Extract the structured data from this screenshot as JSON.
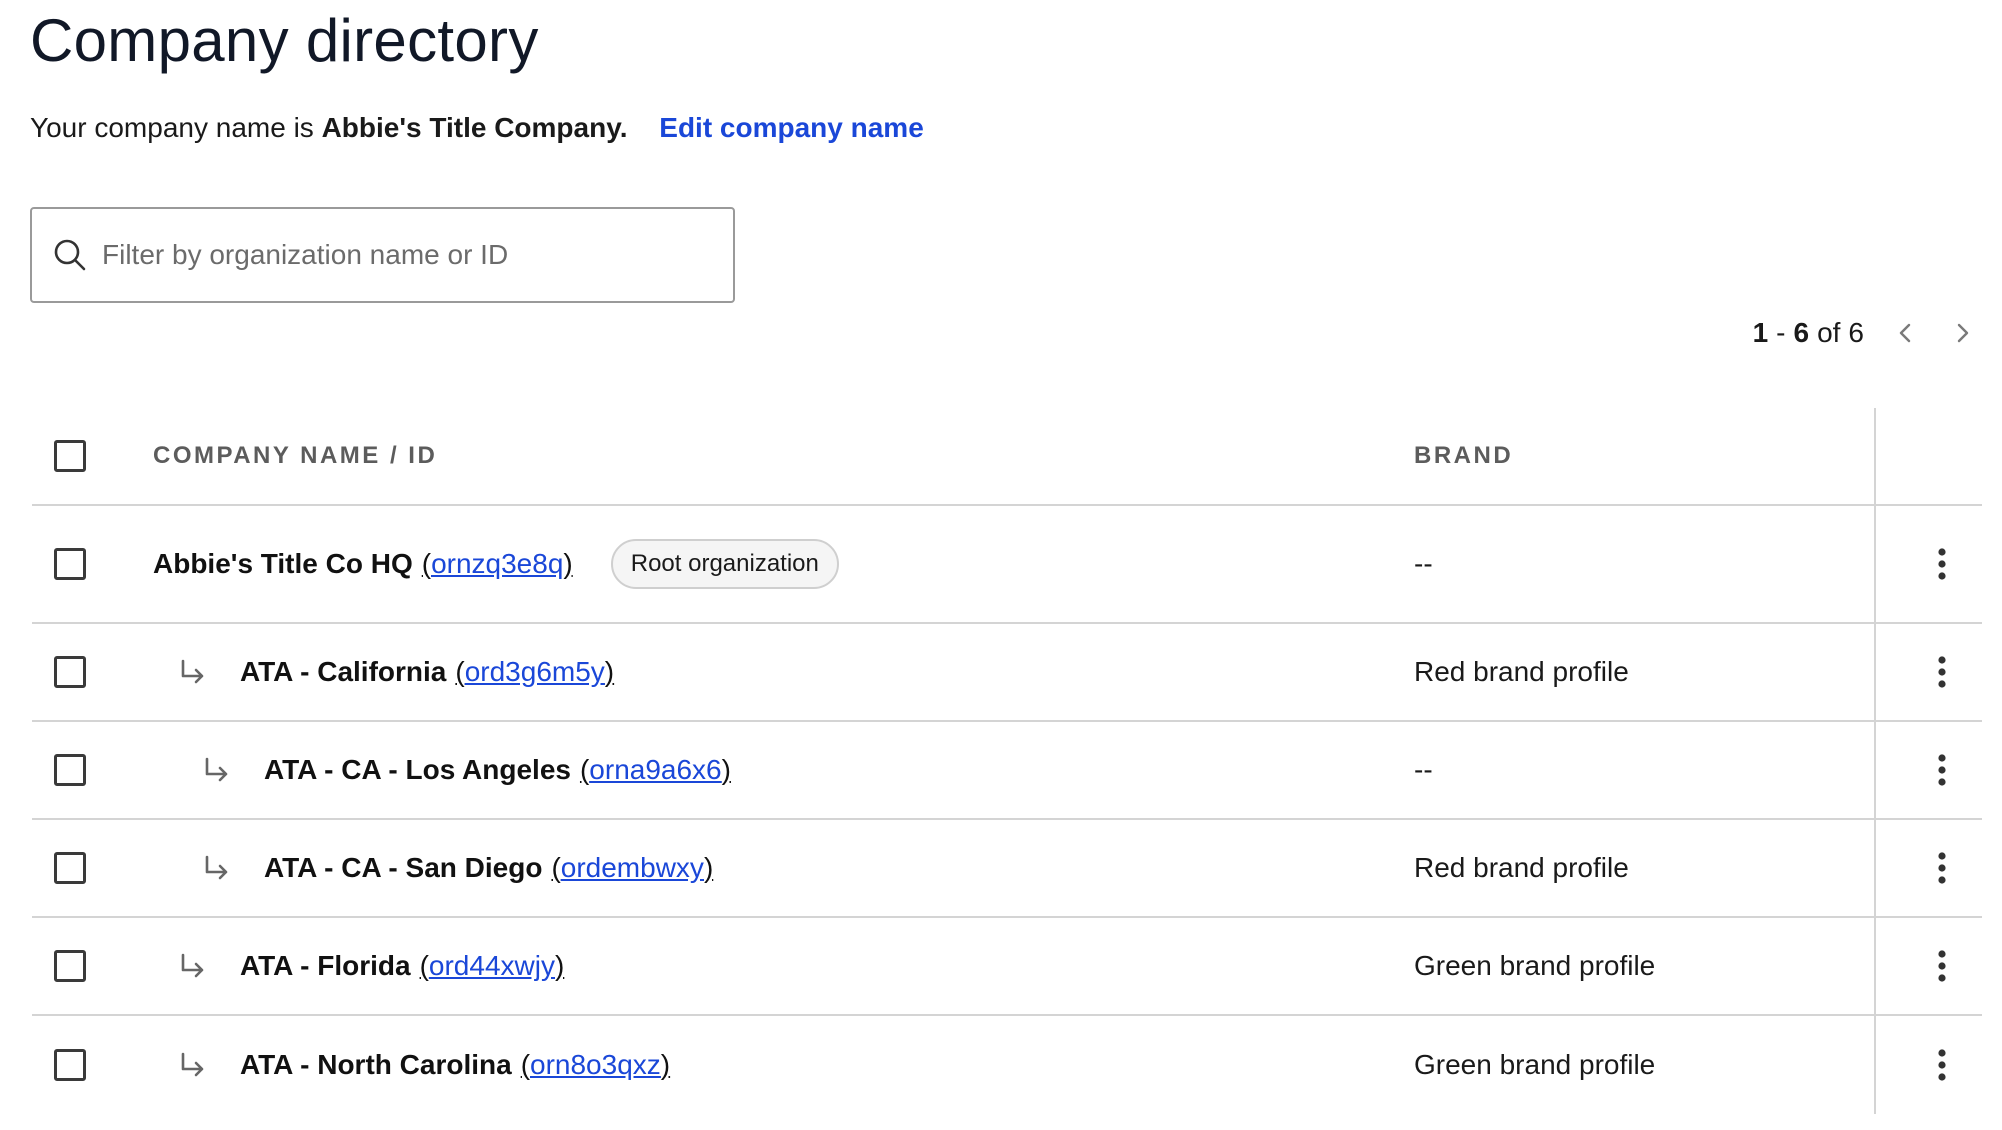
{
  "page": {
    "title": "Company directory",
    "company_prefix": "Your company name is",
    "company_name": "Abbie's Title Company.",
    "edit_label": "Edit company name"
  },
  "search": {
    "placeholder": "Filter by organization name or ID",
    "value": ""
  },
  "pagination": {
    "start": "1",
    "separator": "-",
    "end": "6",
    "of_label": "of",
    "total": "6"
  },
  "table": {
    "columns": {
      "name": "COMPANY NAME / ID",
      "brand": "BRAND"
    },
    "rows": [
      {
        "name": "Abbie's Title Co HQ",
        "id": "ornzq3e8q",
        "badge": "Root organization",
        "brand": "--",
        "level": 0
      },
      {
        "name": "ATA - California",
        "id": "ord3g6m5y",
        "brand": "Red brand profile",
        "level": 1
      },
      {
        "name": "ATA - CA - Los Angeles",
        "id": "orna9a6x6",
        "brand": "--",
        "level": 2
      },
      {
        "name": "ATA - CA - San Diego",
        "id": "ordembwxy",
        "brand": "Red brand profile",
        "level": 2
      },
      {
        "name": "ATA - Florida",
        "id": "ord44xwjy",
        "brand": "Green brand profile",
        "level": 1
      },
      {
        "name": "ATA - North Carolina",
        "id": "orn8o3qxz",
        "brand": "Green brand profile",
        "level": 1
      }
    ]
  },
  "icons": {
    "search": "search-icon",
    "prev": "chevron-left-icon",
    "next": "chevron-right-icon",
    "sub": "subdirectory-arrow-icon",
    "more": "more-vertical-icon"
  },
  "colors": {
    "link": "#1a47d8",
    "border": "#d4d4d4",
    "header_text": "#5c5c5c"
  }
}
